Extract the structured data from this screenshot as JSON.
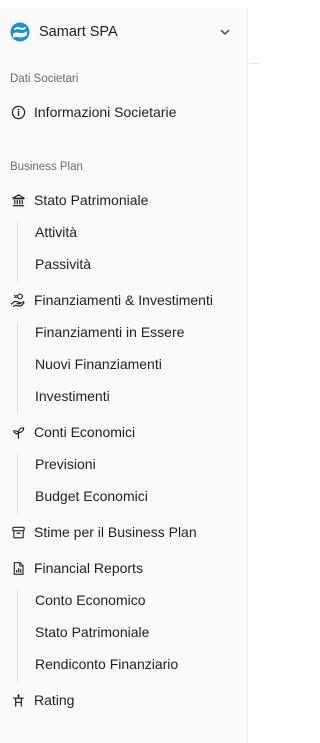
{
  "header": {
    "company_name": "Samart SPA",
    "logo_icon": "company-logo-icon",
    "chevron_icon": "chevron-down-icon"
  },
  "sections": {
    "dati_societari": {
      "label": "Dati Societari",
      "items": {
        "informazioni": {
          "label": "Informazioni Societarie",
          "icon": "info-icon"
        }
      }
    },
    "business_plan": {
      "label": "Business Plan",
      "stato_patrimoniale": {
        "label": "Stato Patrimoniale",
        "icon": "bank-icon",
        "children": [
          "Attività",
          "Passività"
        ]
      },
      "finanziamenti": {
        "label": "Finanziamenti & Investimenti",
        "icon": "hand-coins-icon",
        "children": [
          "Finanziamenti in Essere",
          "Nuovi Finanziamenti",
          "Investimenti"
        ]
      },
      "conti_economici": {
        "label": "Conti Economici",
        "icon": "sprout-icon",
        "children": [
          "Previsioni",
          "Budget Economici"
        ]
      },
      "stime": {
        "label": "Stime per il Business Plan",
        "icon": "archive-icon"
      },
      "financial_reports": {
        "label": "Financial Reports",
        "icon": "file-chart-icon",
        "children": [
          "Conto Economico",
          "Stato Patrimoniale",
          "Rendiconto Finanziario"
        ]
      },
      "rating": {
        "label": "Rating",
        "icon": "podium-icon"
      }
    }
  },
  "colors": {
    "sidebar_bg": "#fafafa",
    "text": "#1f1f1f",
    "section_label": "#6b6b6b",
    "logo_blue": "#1a8fd6"
  }
}
